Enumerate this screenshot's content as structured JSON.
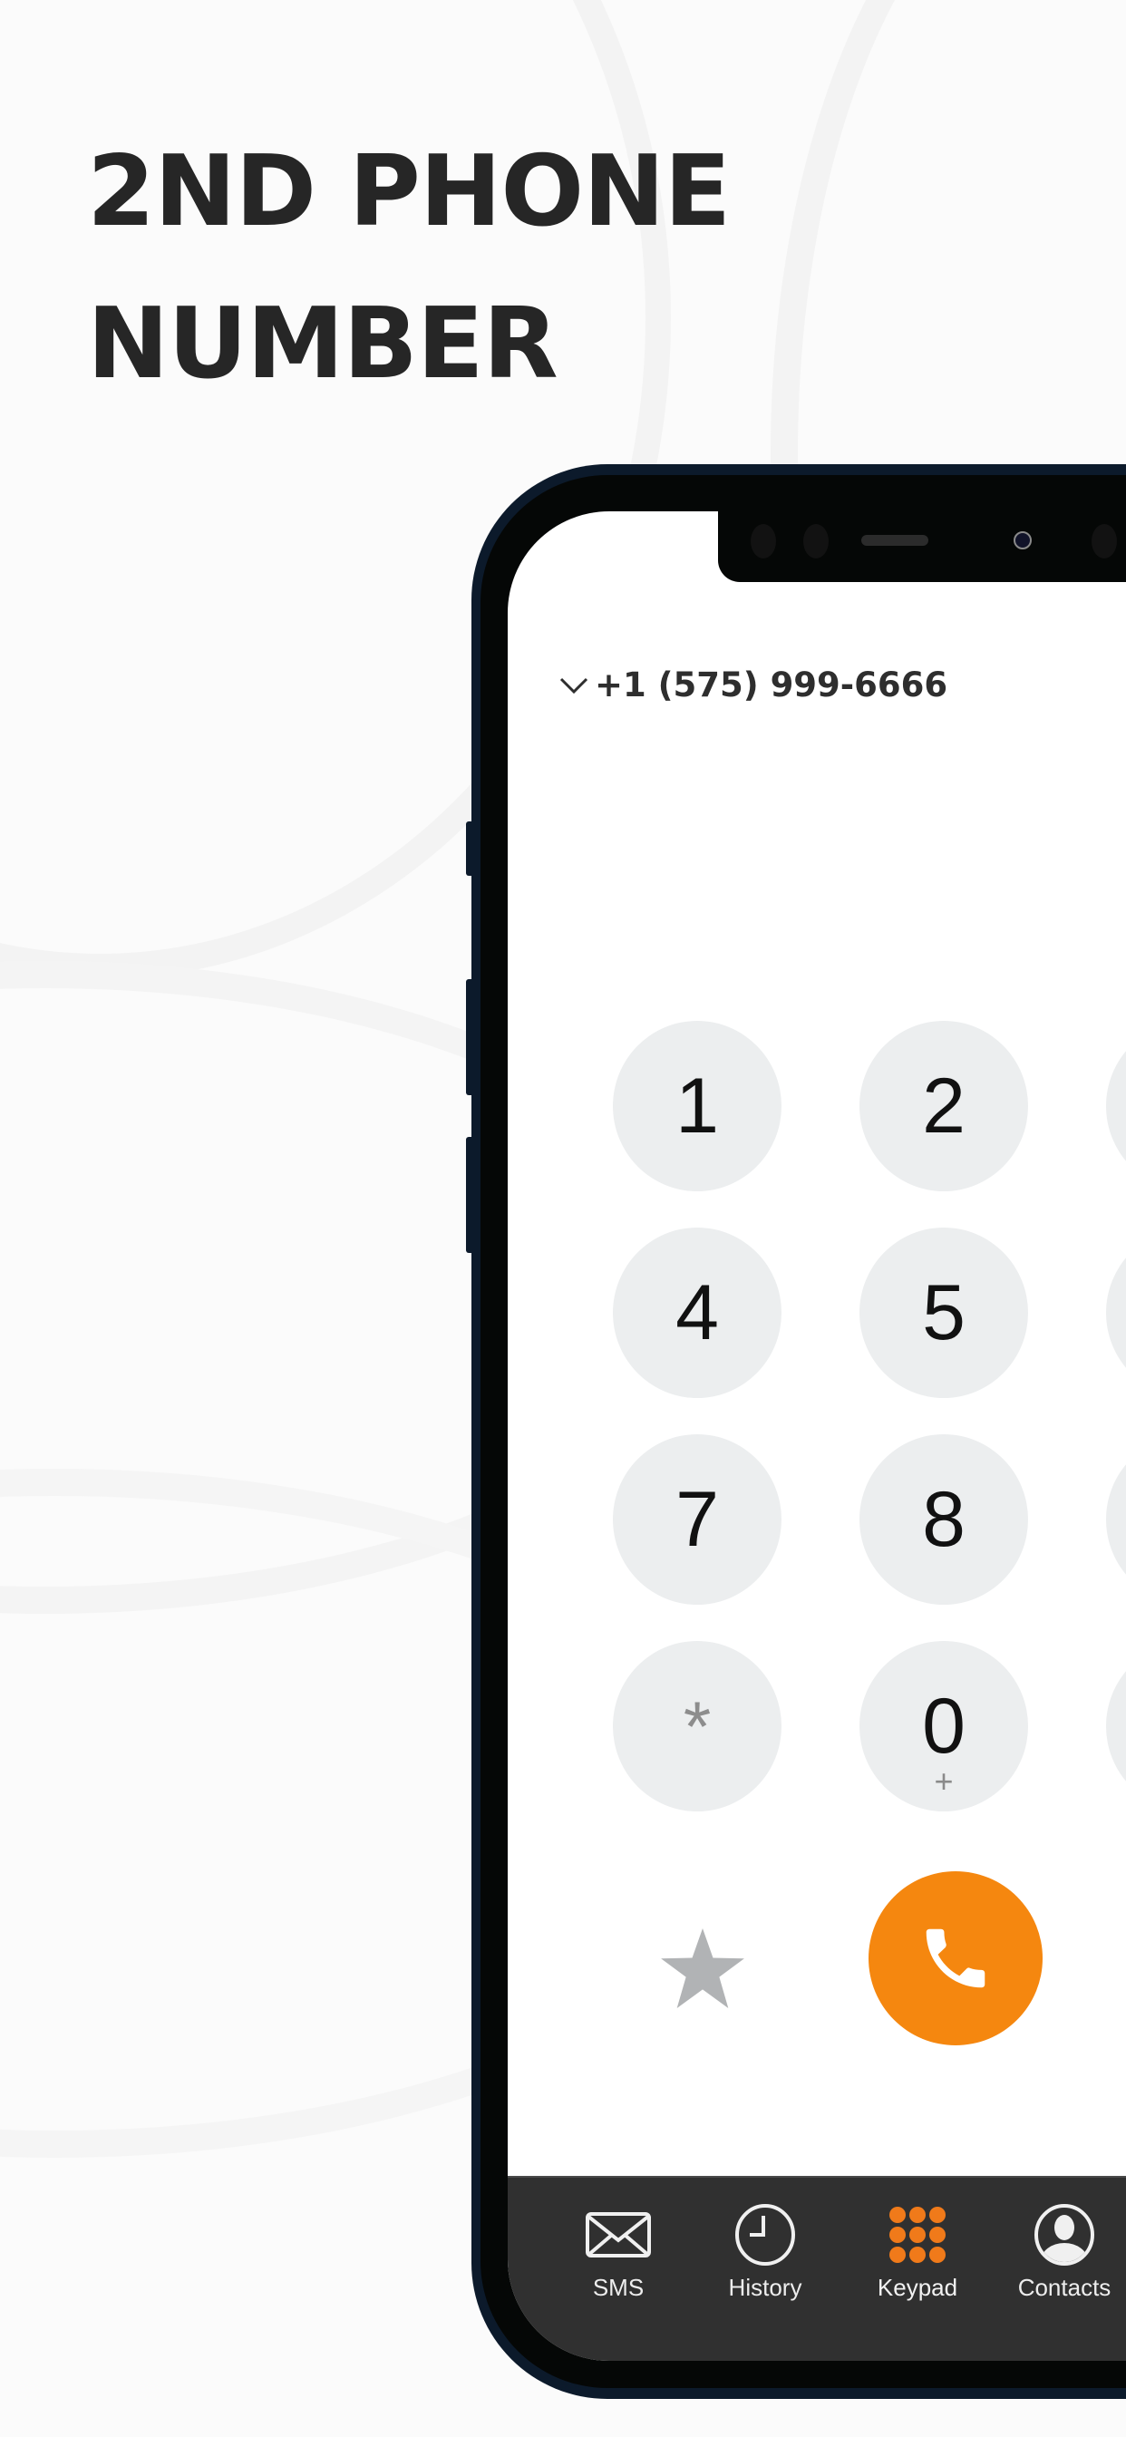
{
  "headline": {
    "line1": "2ND PHONE",
    "line2": "NUMBER"
  },
  "dialer": {
    "selected_number": "+1 (575) 999-6666",
    "selector_icon": "chevron-down-icon",
    "keys": [
      {
        "digit": "1",
        "sub": ""
      },
      {
        "digit": "2",
        "sub": ""
      },
      {
        "digit": "4",
        "sub": ""
      },
      {
        "digit": "5",
        "sub": ""
      },
      {
        "digit": "7",
        "sub": ""
      },
      {
        "digit": "8",
        "sub": ""
      },
      {
        "digit": "*",
        "sub": ""
      },
      {
        "digit": "0",
        "sub": "+"
      }
    ],
    "favorite_icon": "star-icon",
    "call_icon": "phone-icon",
    "accent_color": "#f5870f"
  },
  "tabbar": {
    "tabs": [
      {
        "label": "SMS",
        "icon": "envelope-icon",
        "active": false
      },
      {
        "label": "History",
        "icon": "clock-icon",
        "active": false
      },
      {
        "label": "Keypad",
        "icon": "keypad-grid-icon",
        "active": true
      },
      {
        "label": "Contacts",
        "icon": "contact-person-icon",
        "active": false
      }
    ]
  }
}
